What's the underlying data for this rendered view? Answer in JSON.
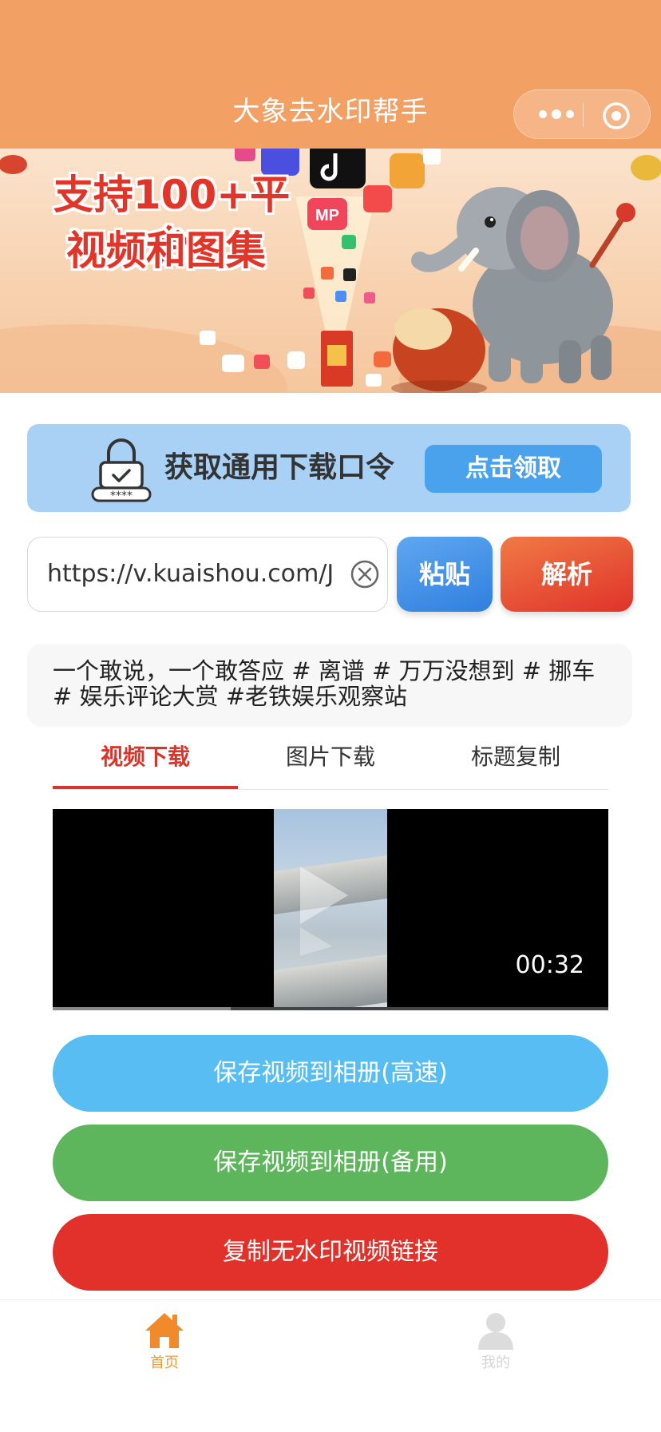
{
  "header": {
    "title": "大象去水印帮手",
    "capsule": {
      "menu_icon": "more-dots-icon",
      "close_icon": "target-close-icon"
    }
  },
  "banner": {
    "line1": "支持100+平台",
    "line2": "视频和图集"
  },
  "coupon": {
    "text": "获取通用下载口令",
    "button": "点击领取",
    "icon": "lock-icon"
  },
  "url_row": {
    "value": "https://v.kuaishou.com/J...",
    "paste": "粘贴",
    "parse": "解析"
  },
  "caption": "一个敢说，一个敢答应 # 离谱 # 万万没想到 # 挪车 # 娱乐评论大赏 #老铁娱乐观察站",
  "tabs": [
    {
      "label": "视频下载",
      "active": true
    },
    {
      "label": "图片下载",
      "active": false
    },
    {
      "label": "标题复制",
      "active": false
    }
  ],
  "video": {
    "duration": "00:32",
    "progress": 0.32
  },
  "actions": {
    "save_fast": "保存视频到相册(高速)",
    "save_backup": "保存视频到相册(备用)",
    "copy_link": "复制无水印视频链接"
  },
  "tabbar": {
    "home": "首页",
    "me": "我的"
  },
  "colors": {
    "header": "#f2a064",
    "accent_red": "#d9362b",
    "blue_button": "#58bdf2",
    "green_button": "#5db55c",
    "red_button": "#e2302a",
    "home_active": "#f09a33"
  }
}
